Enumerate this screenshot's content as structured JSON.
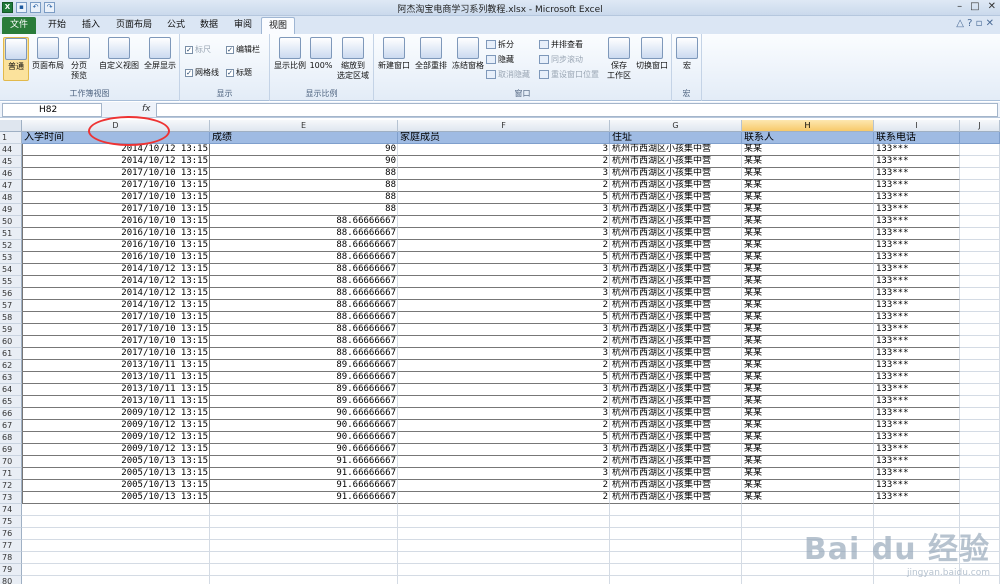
{
  "window": {
    "title": "阿杰淘宝电商学习系列教程.xlsx - Microsoft Excel"
  },
  "tabs": [
    "文件",
    "开始",
    "插入",
    "页面布局",
    "公式",
    "数据",
    "审阅",
    "视图"
  ],
  "ribbon": {
    "workbook_views": {
      "label": "工作簿视图",
      "normal": "普通",
      "page_layout": "页面布局",
      "page_break": "分页\n预览",
      "custom": "自定义视图",
      "fullscreen": "全屏显示"
    },
    "show": {
      "label": "显示",
      "ruler": "标尺",
      "formula_bar": "编辑栏",
      "gridlines": "网格线",
      "headings": "标题"
    },
    "zoom": {
      "label": "显示比例",
      "zoom": "显示比例",
      "hundred": "100%",
      "to_selection": "缩放到\n选定区域"
    },
    "window": {
      "label": "窗口",
      "new_window": "新建窗口",
      "arrange_all": "全部重排",
      "freeze": "冻结窗格",
      "split": "拆分",
      "hide": "隐藏",
      "unhide": "取消隐藏",
      "side_by_side": "并排查看",
      "sync_scroll": "同步滚动",
      "reset_pos": "重设窗口位置",
      "save_ws": "保存\n工作区",
      "switch": "切换窗口"
    },
    "macro": {
      "label": "宏",
      "macro": "宏"
    }
  },
  "formula_bar": {
    "name_box": "H82",
    "fx": "fx",
    "value": ""
  },
  "columns": [
    {
      "id": "D",
      "header": "入学时间"
    },
    {
      "id": "E",
      "header": "成绩"
    },
    {
      "id": "F",
      "header": "家庭成员"
    },
    {
      "id": "G",
      "header": "住址"
    },
    {
      "id": "H",
      "header": "联系人"
    },
    {
      "id": "I",
      "header": "联系电话"
    },
    {
      "id": "J",
      "header": ""
    }
  ],
  "header_row": "1",
  "rows": [
    [
      "44",
      "2014/10/12 13:15",
      "90",
      "3",
      "杭州市西湖区小孩集中营",
      "某某",
      "133***"
    ],
    [
      "45",
      "2014/10/12 13:15",
      "90",
      "2",
      "杭州市西湖区小孩集中营",
      "某某",
      "133***"
    ],
    [
      "46",
      "2017/10/10 13:15",
      "88",
      "3",
      "杭州市西湖区小孩集中营",
      "某某",
      "133***"
    ],
    [
      "47",
      "2017/10/10 13:15",
      "88",
      "2",
      "杭州市西湖区小孩集中营",
      "某某",
      "133***"
    ],
    [
      "48",
      "2017/10/10 13:15",
      "88",
      "5",
      "杭州市西湖区小孩集中营",
      "某某",
      "133***"
    ],
    [
      "49",
      "2017/10/10 13:15",
      "88",
      "3",
      "杭州市西湖区小孩集中营",
      "某某",
      "133***"
    ],
    [
      "50",
      "2016/10/10 13:15",
      "88.66666667",
      "2",
      "杭州市西湖区小孩集中营",
      "某某",
      "133***"
    ],
    [
      "51",
      "2016/10/10 13:15",
      "88.66666667",
      "3",
      "杭州市西湖区小孩集中营",
      "某某",
      "133***"
    ],
    [
      "52",
      "2016/10/10 13:15",
      "88.66666667",
      "2",
      "杭州市西湖区小孩集中营",
      "某某",
      "133***"
    ],
    [
      "53",
      "2016/10/10 13:15",
      "88.66666667",
      "5",
      "杭州市西湖区小孩集中营",
      "某某",
      "133***"
    ],
    [
      "54",
      "2014/10/12 13:15",
      "88.66666667",
      "3",
      "杭州市西湖区小孩集中营",
      "某某",
      "133***"
    ],
    [
      "55",
      "2014/10/12 13:15",
      "88.66666667",
      "2",
      "杭州市西湖区小孩集中营",
      "某某",
      "133***"
    ],
    [
      "56",
      "2014/10/12 13:15",
      "88.66666667",
      "3",
      "杭州市西湖区小孩集中营",
      "某某",
      "133***"
    ],
    [
      "57",
      "2014/10/12 13:15",
      "88.66666667",
      "2",
      "杭州市西湖区小孩集中营",
      "某某",
      "133***"
    ],
    [
      "58",
      "2017/10/10 13:15",
      "88.66666667",
      "5",
      "杭州市西湖区小孩集中营",
      "某某",
      "133***"
    ],
    [
      "59",
      "2017/10/10 13:15",
      "88.66666667",
      "3",
      "杭州市西湖区小孩集中营",
      "某某",
      "133***"
    ],
    [
      "60",
      "2017/10/10 13:15",
      "88.66666667",
      "2",
      "杭州市西湖区小孩集中营",
      "某某",
      "133***"
    ],
    [
      "61",
      "2017/10/10 13:15",
      "88.66666667",
      "3",
      "杭州市西湖区小孩集中营",
      "某某",
      "133***"
    ],
    [
      "62",
      "2013/10/11 13:15",
      "89.66666667",
      "2",
      "杭州市西湖区小孩集中营",
      "某某",
      "133***"
    ],
    [
      "63",
      "2013/10/11 13:15",
      "89.66666667",
      "5",
      "杭州市西湖区小孩集中营",
      "某某",
      "133***"
    ],
    [
      "64",
      "2013/10/11 13:15",
      "89.66666667",
      "3",
      "杭州市西湖区小孩集中营",
      "某某",
      "133***"
    ],
    [
      "65",
      "2013/10/11 13:15",
      "89.66666667",
      "2",
      "杭州市西湖区小孩集中营",
      "某某",
      "133***"
    ],
    [
      "66",
      "2009/10/12 13:15",
      "90.66666667",
      "3",
      "杭州市西湖区小孩集中营",
      "某某",
      "133***"
    ],
    [
      "67",
      "2009/10/12 13:15",
      "90.66666667",
      "2",
      "杭州市西湖区小孩集中营",
      "某某",
      "133***"
    ],
    [
      "68",
      "2009/10/12 13:15",
      "90.66666667",
      "5",
      "杭州市西湖区小孩集中营",
      "某某",
      "133***"
    ],
    [
      "69",
      "2009/10/12 13:15",
      "90.66666667",
      "3",
      "杭州市西湖区小孩集中营",
      "某某",
      "133***"
    ],
    [
      "70",
      "2005/10/13 13:15",
      "91.66666667",
      "2",
      "杭州市西湖区小孩集中营",
      "某某",
      "133***"
    ],
    [
      "71",
      "2005/10/13 13:15",
      "91.66666667",
      "3",
      "杭州市西湖区小孩集中营",
      "某某",
      "133***"
    ],
    [
      "72",
      "2005/10/13 13:15",
      "91.66666667",
      "2",
      "杭州市西湖区小孩集中营",
      "某某",
      "133***"
    ],
    [
      "73",
      "2005/10/13 13:15",
      "91.66666667",
      "2",
      "杭州市西湖区小孩集中营",
      "某某",
      "133***"
    ]
  ],
  "empty_rows": [
    "74",
    "75",
    "76",
    "77",
    "78",
    "79",
    "80"
  ],
  "watermark": {
    "logo": "Bai du 经验",
    "url": "jingyan.baidu.com"
  },
  "colors": {
    "header_fill": "#9fbbe3",
    "file_tab": "#2a7c3a",
    "active_col": "#f7c96a",
    "annotation": "#ee3333"
  }
}
